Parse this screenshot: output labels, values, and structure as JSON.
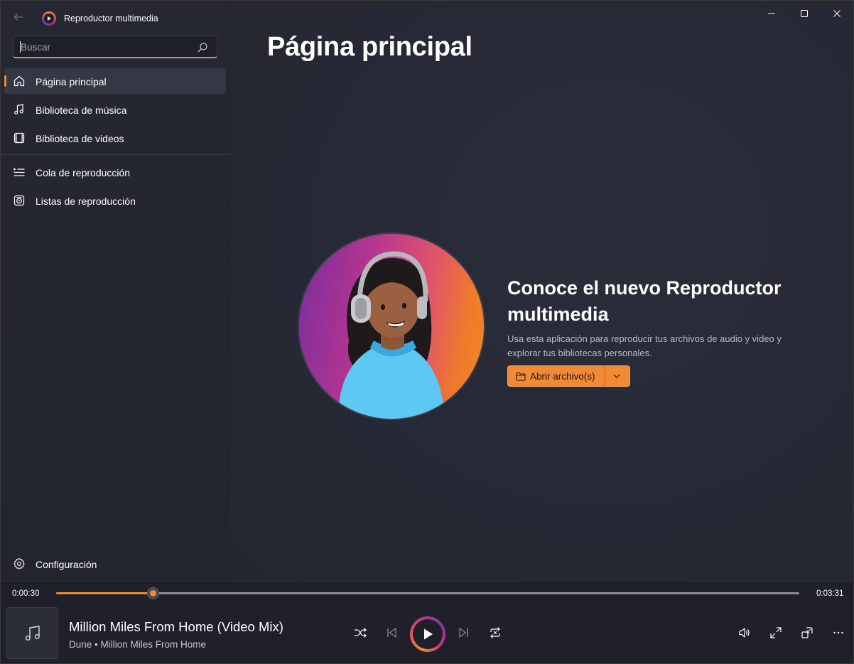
{
  "app": {
    "title": "Reproductor multimedia"
  },
  "search": {
    "placeholder": "Buscar"
  },
  "nav": {
    "items": [
      {
        "label": "Página principal",
        "icon": "home-icon",
        "active": true
      },
      {
        "label": "Biblioteca de música",
        "icon": "music-note-icon",
        "active": false
      },
      {
        "label": "Biblioteca de videos",
        "icon": "film-icon",
        "active": false
      },
      {
        "label": "Cola de reproducción",
        "icon": "queue-icon",
        "active": false
      },
      {
        "label": "Listas de reproducción",
        "icon": "playlist-icon",
        "active": false
      }
    ],
    "settings_label": "Configuración"
  },
  "main": {
    "page_title": "Página principal",
    "hero_title": "Conoce el nuevo Reproductor multimedia",
    "hero_description": "Usa esta aplicación para reproducir tus archivos de audio y video y explorar tus bibliotecas personales.",
    "open_button_label": "Abrir archivo(s)"
  },
  "player": {
    "elapsed": "0:00:30",
    "duration": "0:03:31",
    "progress_fraction": 0.13,
    "song_title": "Million Miles From Home (Video Mix)",
    "song_subtitle": "Dune • Million Miles From Home"
  },
  "colors": {
    "accent": "#f08a35",
    "sidebar_bg": "#252733",
    "main_bg": "#272a36",
    "player_bg": "#1f2029"
  }
}
